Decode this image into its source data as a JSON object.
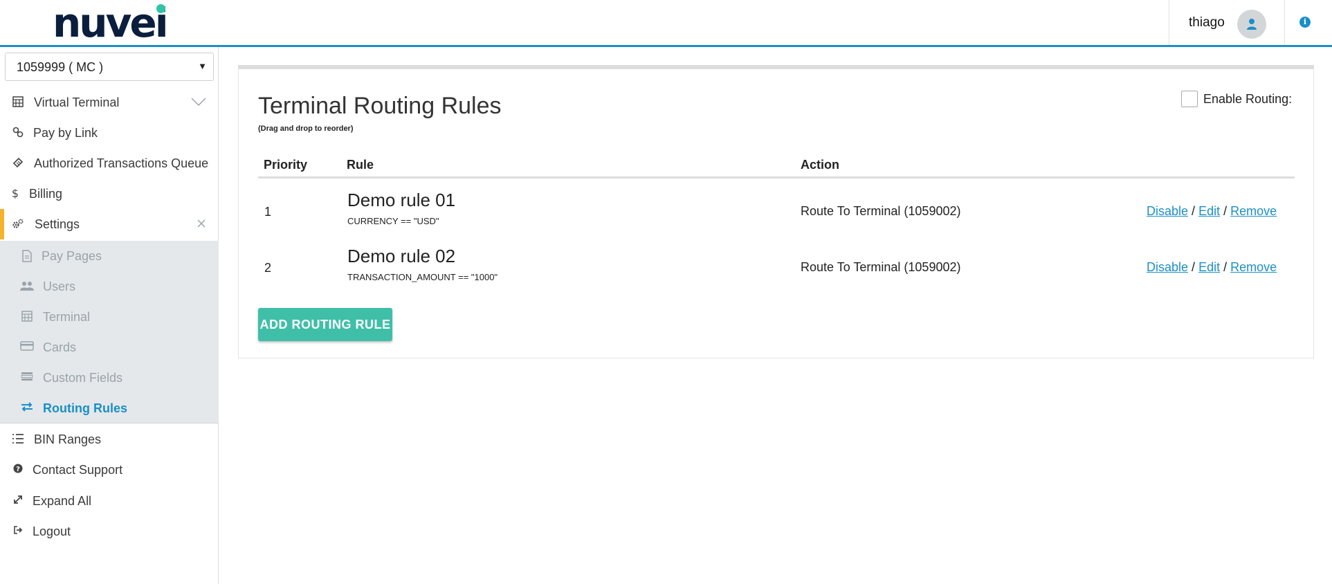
{
  "header": {
    "logo_text": "nuvei",
    "username": "thiago",
    "user_icon": "user-icon",
    "info_icon": "info-icon"
  },
  "sidebar": {
    "merchant_select": {
      "value": "1059999 ( MC )"
    },
    "items": [
      {
        "label": "Virtual Terminal",
        "icon": "calculator-icon"
      },
      {
        "label": "Pay by Link",
        "icon": "link-icon"
      },
      {
        "label": "Authorized Transactions Queue",
        "icon": "ticket-icon"
      },
      {
        "label": "Billing",
        "icon": "dollar-icon"
      },
      {
        "label": "Settings",
        "icon": "gears-icon"
      },
      {
        "label": "BIN Ranges",
        "icon": "list-icon"
      },
      {
        "label": "Contact Support",
        "icon": "question-icon"
      },
      {
        "label": "Expand All",
        "icon": "expand-icon"
      },
      {
        "label": "Logout",
        "icon": "logout-icon"
      }
    ],
    "settings_submenu": [
      {
        "label": "Pay Pages",
        "icon": "page-icon"
      },
      {
        "label": "Users",
        "icon": "users-icon"
      },
      {
        "label": "Terminal",
        "icon": "calculator-icon"
      },
      {
        "label": "Cards",
        "icon": "card-icon"
      },
      {
        "label": "Custom Fields",
        "icon": "fields-icon"
      },
      {
        "label": "Routing Rules",
        "icon": "exchange-icon"
      }
    ]
  },
  "main": {
    "title": "Terminal Routing Rules",
    "subtitle": "(Drag and drop to reorder)",
    "enable_routing_label": "Enable Routing:",
    "enable_routing_checked": false,
    "columns": {
      "priority": "Priority",
      "rule": "Rule",
      "action": "Action"
    },
    "rules": [
      {
        "priority": "1",
        "name": "Demo rule 01",
        "condition": "CURRENCY == \"USD\"",
        "action": "Route To Terminal (1059002)",
        "disable": "Disable",
        "edit": "Edit",
        "remove": "Remove",
        "sep": "/"
      },
      {
        "priority": "2",
        "name": "Demo rule 02",
        "condition": "TRANSACTION_AMOUNT == \"1000\"",
        "action": "Route To Terminal (1059002)",
        "disable": "Disable",
        "edit": "Edit",
        "remove": "Remove",
        "sep": "/"
      }
    ],
    "add_button": "ADD ROUTING RULE"
  },
  "colors": {
    "brand_blue": "#1a8fc7",
    "brand_green": "#3fbfa8",
    "active_accent": "#f5b32a",
    "logo_navy": "#0b1e3d"
  }
}
